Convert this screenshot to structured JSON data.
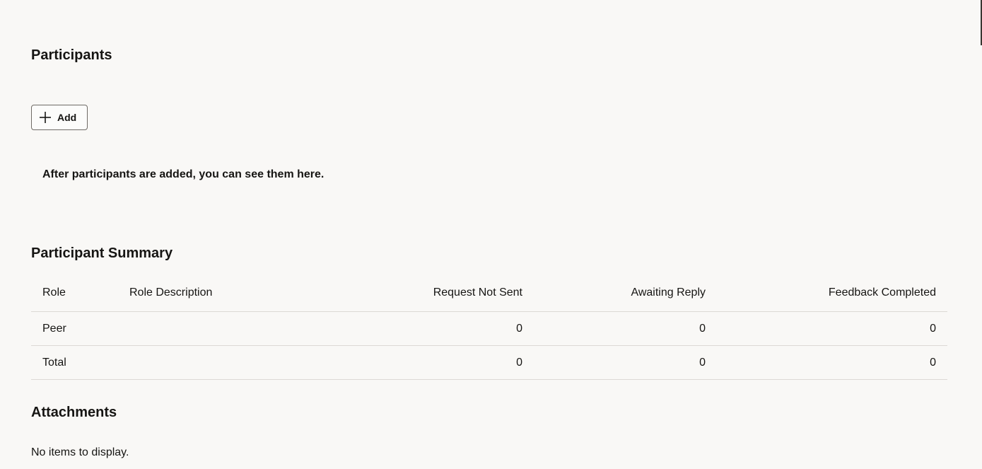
{
  "participants": {
    "title": "Participants",
    "add_button_label": "Add",
    "empty_message": "After participants are added, you can see them here."
  },
  "summary": {
    "title": "Participant Summary",
    "columns": {
      "role": "Role",
      "role_description": "Role Description",
      "request_not_sent": "Request Not Sent",
      "awaiting_reply": "Awaiting Reply",
      "feedback_completed": "Feedback Completed"
    },
    "rows": [
      {
        "role": "Peer",
        "role_description": "",
        "request_not_sent": "0",
        "awaiting_reply": "0",
        "feedback_completed": "0"
      },
      {
        "role": "Total",
        "role_description": "",
        "request_not_sent": "0",
        "awaiting_reply": "0",
        "feedback_completed": "0"
      }
    ]
  },
  "attachments": {
    "title": "Attachments",
    "empty_message": "No items to display."
  }
}
